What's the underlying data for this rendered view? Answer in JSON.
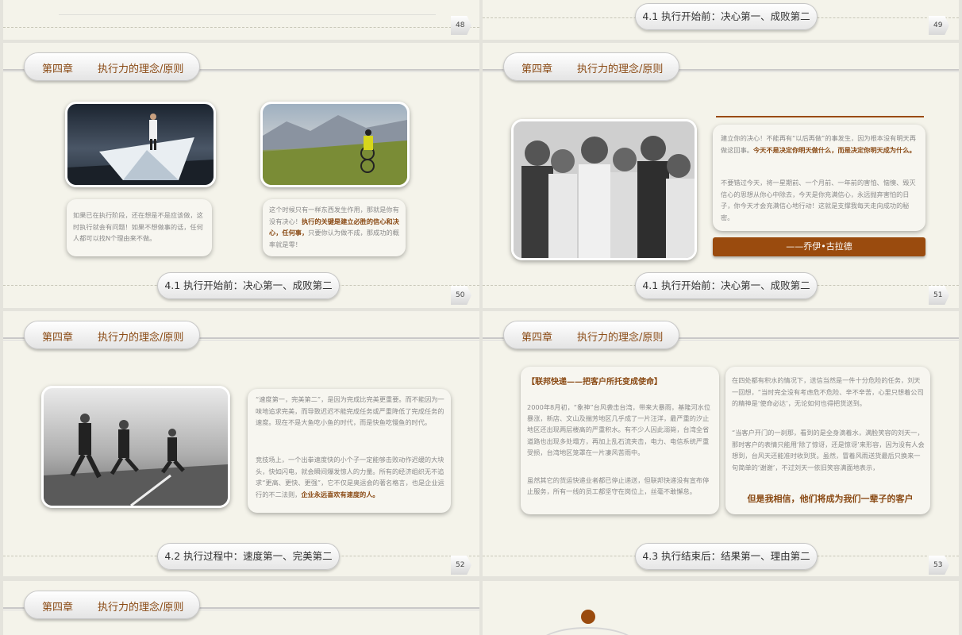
{
  "chapter_label": "第四章",
  "chapter_title": "执行力的理念/原则",
  "slide48": {
    "page": "48"
  },
  "slide49": {
    "footer": "4.1 执行开始前：决心第一、成败第二",
    "page": "49"
  },
  "slide50": {
    "footer": "4.1 执行开始前：决心第一、成败第二",
    "page": "50",
    "left_text": "如果已在执行阶段，还在想是不是应该做，这时执行就会有问题！如果不想做事的话，任何人都可以找N个理由来不做。",
    "right_text_a": "这个时候只有一样东西发生作用，那就是你有没有决心！",
    "right_highlight": "执行的关键是建立必胜的信心和决心，任何事，",
    "right_text_b": "只要你认为做不成，那成功的概率就是零！"
  },
  "slide51": {
    "footer": "4.1 执行开始前：决心第一、成败第二",
    "page": "51",
    "para1_a": "建立你的决心！不能再有“以后再做”的事发生，因为根本没有明天再做这回事。",
    "para1_highlight": "今天不是决定你明天做什么，而是决定你明天成为什么。",
    "para2": "不要错过今天，将一星期前、一个月前、一年前的害怕、恼懊、毁灭信心的思想从你心中除去，今天是你充满信心，永远抛弃害怕的日子，你今天才会充满信心地行动！这就是支撑我每天走向成功的秘密。",
    "author": "——乔伊•古拉德"
  },
  "slide52": {
    "footer": "4.2 执行过程中：速度第一、完美第二",
    "page": "52",
    "para1": "“速度第一，完美第二”，是因为完成比完美更重要。而不能因为一味地追求完美，而导致迟迟不能完成任务或严重降低了完成任务的速度。现在不是大鱼吃小鱼的时代，而是快鱼吃慢鱼的时代。",
    "para2_a": "竞技场上，一个出拳速度快的小个子一定能够击败动作迟缓的大块头，快如闪电，就会瞬间爆发惊人的力量。所有的经济组织无不追求“更高、更快、更强”，它不仅是奥运会的著名格言，也是企业运行的不二法则，",
    "para2_highlight": "企业永远喜欢有速度的人。"
  },
  "slide53": {
    "footer": "4.3 执行结束后：结果第一、理由第二",
    "page": "53",
    "left_title": "【联邦快递——把客户所托变成使命】",
    "left_para1": "2000年8月初，“象神”台风袭击台湾，带来大暴雨，基隆河水位暴涨，新店、文山及揣芳地区几乎成了一片汪洋，最严重的汐止地区还出现两层楼高的严重积水。有不少人因此溺毙，台湾全省道路也出现多处塌方，再加上乱石流夹击，电力、电信系统严重受损，台湾地区笼罩在一片凄风苦雨中。",
    "left_para2": "虽然其它的货运快递业者都已停止递送，但联邦快递没有宣布停止服务，所有一线的员工都坚守在岗位上，丝毫不敢懈怠。",
    "right_para1": "在四处都有积水的情况下，送信当然是一件十分危险的任务，刘天一回想，“当时完全没有考虑危不危险、辛不辛苦，心里只想着公司的精神是‘使命必达’，无论如何也得把货送到。",
    "right_para2": "“当客户开门的一刹那，看到的是全身滴着水，满脸笑容的刘天一，那时客户的表情只能用‘除了惊讶，还是惊讶’来形容，因为没有人会想到，台风天还能准时收到货。虽然，冒着风雨送货最后只换来一句简单的‘谢谢’，不过刘天一依旧笑容满面地表示，",
    "right_quote": "但是我相信，他们将成为我们一辈子的客户"
  },
  "colors": {
    "accent": "#8a4a14",
    "author_bar": "#9a4b0e"
  }
}
